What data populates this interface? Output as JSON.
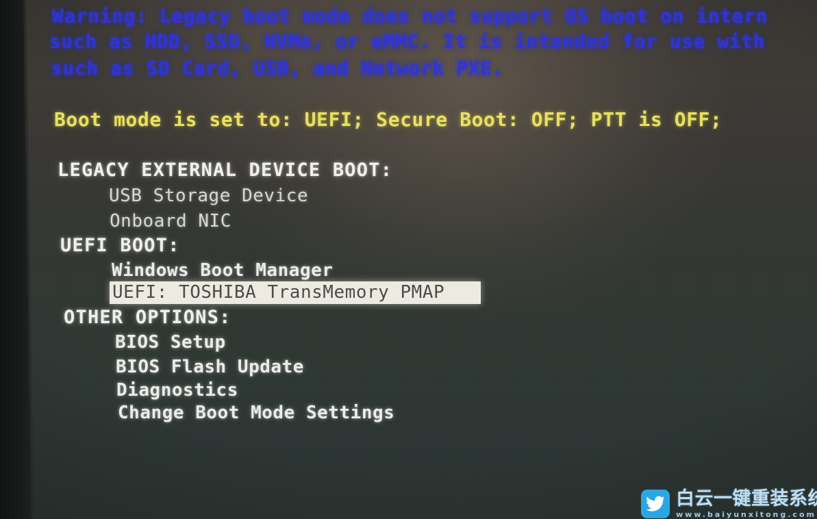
{
  "screen": {
    "kind": "bios-boot-menu",
    "bg_top_color": "#3b3833",
    "bg_bottom_color": "#2b3431",
    "warning_color": "#2e33e2",
    "status_color": "#e9e263",
    "header_color": "#f2f2ee",
    "item_color": "#d9d9d4",
    "highlight_bg": "#efece4",
    "highlight_fg": "#4c4c4a"
  },
  "warning": {
    "lines": [
      "Warning: Legacy boot mode does not support OS boot on intern",
      "such as HDD, SSD, NVMe, or eMMC. It is intended for use with",
      "such as SD Card, USB, and Network PXE."
    ]
  },
  "status": {
    "text": "Boot mode is set to: UEFI; Secure Boot: OFF; PTT is OFF;"
  },
  "menu": {
    "sections": [
      {
        "header": "LEGACY EXTERNAL DEVICE BOOT:",
        "items": [
          {
            "label": "USB Storage Device",
            "selected": false
          },
          {
            "label": "Onboard NIC",
            "selected": false
          }
        ]
      },
      {
        "header": "UEFI BOOT:",
        "items": [
          {
            "label": "Windows Boot Manager",
            "selected": false
          },
          {
            "label": "UEFI: TOSHIBA TransMemory PMAP",
            "selected": true
          }
        ]
      },
      {
        "header": "OTHER OPTIONS:",
        "items": [
          {
            "label": "BIOS Setup",
            "selected": false
          },
          {
            "label": "BIOS Flash Update",
            "selected": false
          },
          {
            "label": "Diagnostics",
            "selected": false
          },
          {
            "label": "Change Boot Mode Settings",
            "selected": false
          }
        ]
      }
    ]
  },
  "watermark": {
    "icon": "bird-icon",
    "brand": "白云一键重装系统",
    "url": "www.baiyunxitong.com",
    "badge_color": "#2ba6e4"
  }
}
